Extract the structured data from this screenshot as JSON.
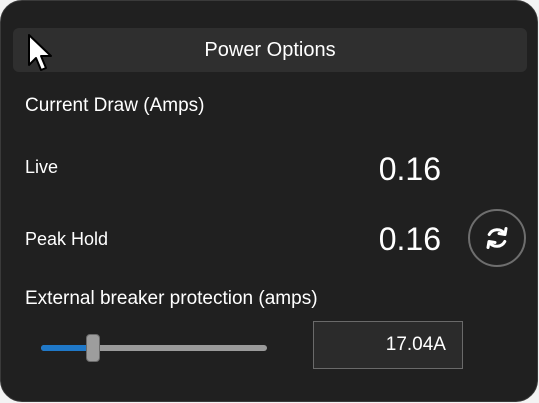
{
  "header": {
    "title": "Power Options"
  },
  "current_draw": {
    "section_label": "Current Draw (Amps)",
    "live_label": "Live",
    "live_value": "0.16",
    "peak_label": "Peak Hold",
    "peak_value": "0.16",
    "reset_icon": "refresh-icon"
  },
  "breaker": {
    "label": "External breaker protection (amps)",
    "value": "17.04A",
    "slider_level": 0.23
  },
  "colors": {
    "panel_background": "#202020",
    "header_background": "#2f2f2f",
    "accent": "#1f78c8",
    "text": "#ffffff"
  }
}
